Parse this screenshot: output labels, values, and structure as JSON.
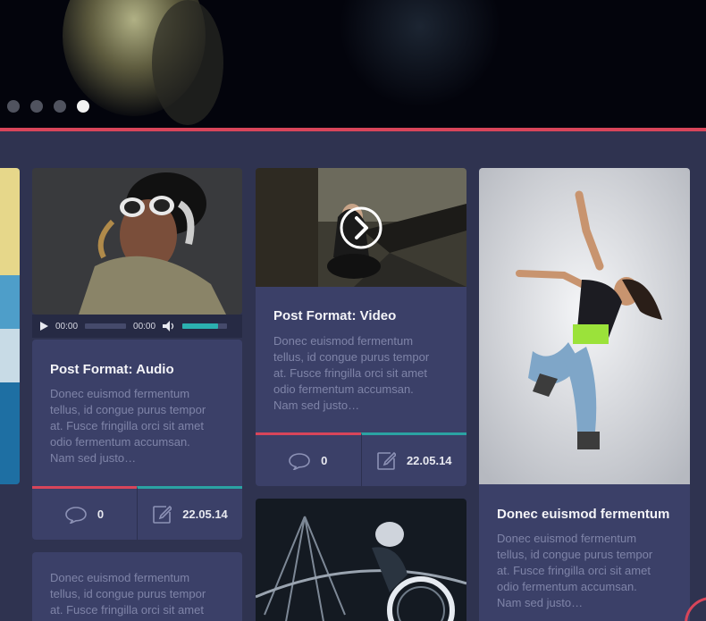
{
  "slider": {
    "dots": [
      {
        "label": "slide-1",
        "active": false
      },
      {
        "label": "slide-2",
        "active": false
      },
      {
        "label": "slide-3",
        "active": false
      },
      {
        "label": "slide-4",
        "active": true
      }
    ]
  },
  "cards": {
    "audio": {
      "player": {
        "current_time": "00:00",
        "duration": "00:00",
        "volume_level": 0.8
      },
      "title": "Post Format: Audio",
      "excerpt": [
        "Donec euismod fermentum",
        "tellus, id congue purus tempor",
        "at. Fusce fringilla orci sit amet",
        "odio fermentum accumsan.",
        "Nam sed justo…"
      ],
      "comments": "0",
      "date": "22.05.14"
    },
    "video": {
      "title": "Post Format: Video",
      "excerpt": [
        "Donec euismod fermentum",
        "tellus, id congue purus tempor",
        "at. Fusce fringilla orci sit amet",
        "odio fermentum accumsan.",
        "Nam sed justo…"
      ],
      "comments": "0",
      "date": "22.05.14"
    },
    "image": {
      "title": "Donec euismod fermentum",
      "excerpt": [
        "Donec euismod fermentum",
        "tellus, id congue purus tempor",
        "at. Fusce fringilla orci sit amet",
        "odio fermentum accumsan.",
        "Nam sed justo…"
      ]
    },
    "text_bottom": {
      "excerpt": [
        "Donec euismod fermentum",
        "tellus, id congue purus tempor",
        "at. Fusce fringilla orci sit amet"
      ]
    }
  },
  "colors": {
    "accent_red": "#d8455a",
    "accent_teal": "#2ba3a3",
    "card_bg": "#3b4068",
    "page_bg": "#2f3350"
  }
}
